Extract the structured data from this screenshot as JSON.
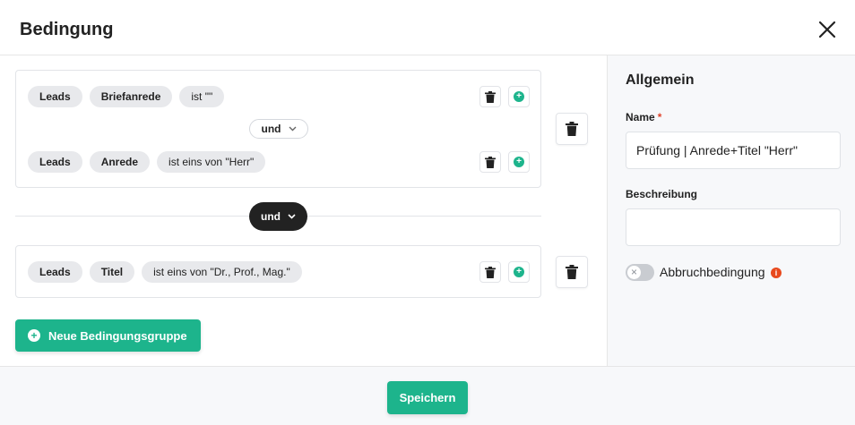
{
  "dialog": {
    "title": "Bedingung",
    "close_icon": "close-icon"
  },
  "groups": [
    {
      "conditions": [
        {
          "chips": [
            "Leads",
            "Briefanrede",
            "ist \"\""
          ]
        },
        {
          "chips": [
            "Leads",
            "Anrede",
            "ist eins von \"Herr\""
          ]
        }
      ],
      "inner_operator": "und"
    },
    {
      "conditions": [
        {
          "chips": [
            "Leads",
            "Titel",
            "ist eins von \"Dr., Prof., Mag.\""
          ]
        }
      ]
    }
  ],
  "outer_operator": "und",
  "new_group_label": "Neue Bedingungsgruppe",
  "sidebar": {
    "title": "Allgemein",
    "name_label": "Name",
    "name_required": "*",
    "name_value": "Prüfung | Anrede+Titel \"Herr\"",
    "description_label": "Beschreibung",
    "description_value": "",
    "toggle_label": "Abbruchbedingung",
    "toggle_on": false,
    "info_icon": "i"
  },
  "footer": {
    "save_label": "Speichern"
  },
  "colors": {
    "accent": "#1db48c",
    "dark": "#222222",
    "info": "#e8491d"
  }
}
